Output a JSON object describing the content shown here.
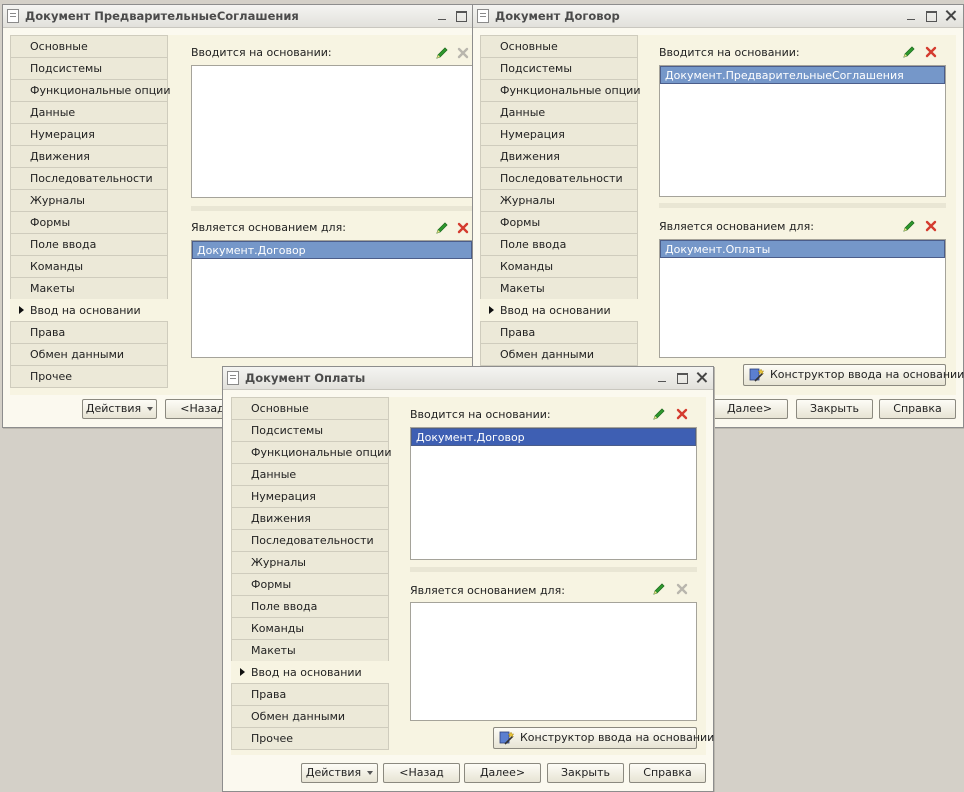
{
  "tabs": [
    "Основные",
    "Подсистемы",
    "Функциональные опции",
    "Данные",
    "Нумерация",
    "Движения",
    "Последовательности",
    "Журналы",
    "Формы",
    "Поле ввода",
    "Команды",
    "Макеты",
    "Ввод на основании",
    "Права",
    "Обмен данными",
    "Прочее"
  ],
  "labels": {
    "based_on": "Вводится на основании:",
    "is_basis_for": "Является основанием для:",
    "constructor": "Конструктор ввода на основании"
  },
  "buttons": {
    "actions": "Действия",
    "back": "<Назад",
    "next": "Далее>",
    "close": "Закрыть",
    "help": "Справка"
  },
  "windows": {
    "predv": {
      "title": "Документ ПредварительныеСоглашения",
      "based_on_items": [],
      "basis_for_items": [
        "Документ.Договор"
      ]
    },
    "dogovor": {
      "title": "Документ Договор",
      "based_on_items": [
        "Документ.ПредварительныеСоглашения"
      ],
      "basis_for_items": [
        "Документ.Оплаты"
      ]
    },
    "oplaty": {
      "title": "Документ Оплаты",
      "based_on_items": [
        "Документ.Договор"
      ],
      "basis_for_items": []
    }
  },
  "colors": {
    "selection": "#7597c9",
    "selection_focused": "#3e5fb3",
    "edit_icon": "#2e9a2e",
    "delete_icon": "#d43b2f",
    "disabled_icon": "#b9b6ad"
  },
  "icons": {
    "edit": "pencil-icon",
    "delete": "cross-icon",
    "constructor": "wand-icon"
  }
}
